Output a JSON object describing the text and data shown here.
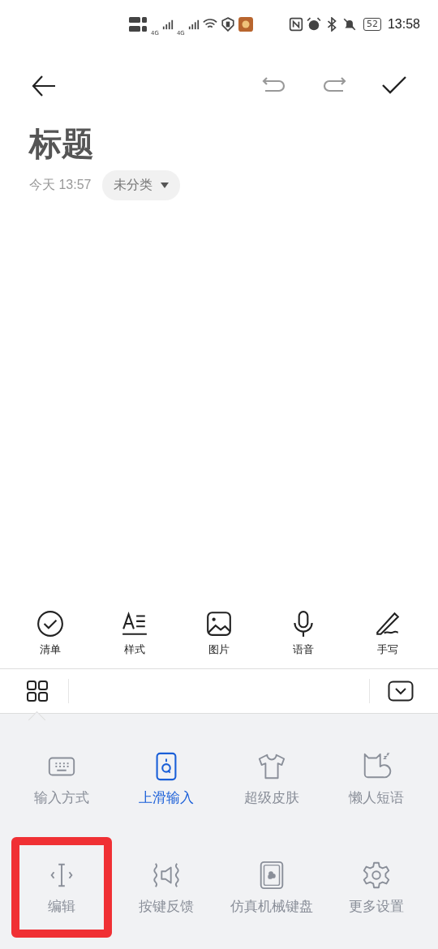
{
  "status_bar": {
    "networks": [
      "4G",
      "4G"
    ],
    "battery": "52",
    "time": "13:58"
  },
  "header": {
    "title": "标题",
    "date": "今天 13:57",
    "category": "未分类"
  },
  "toolbar": [
    {
      "kind": "checklist",
      "label": "清单"
    },
    {
      "kind": "style",
      "label": "样式"
    },
    {
      "kind": "image",
      "label": "图片"
    },
    {
      "kind": "voice",
      "label": "语音"
    },
    {
      "kind": "handwrite",
      "label": "手写"
    }
  ],
  "keyboard_menu": [
    {
      "kind": "keyboard",
      "label": "输入方式",
      "selected": false,
      "highlighted": false
    },
    {
      "kind": "swipe",
      "label": "上滑输入",
      "selected": true,
      "highlighted": false
    },
    {
      "kind": "skin",
      "label": "超级皮肤",
      "selected": false,
      "highlighted": false
    },
    {
      "kind": "phrases",
      "label": "懒人短语",
      "selected": false,
      "highlighted": false
    },
    {
      "kind": "edit",
      "label": "编辑",
      "selected": false,
      "highlighted": true
    },
    {
      "kind": "feedback",
      "label": "按键反馈",
      "selected": false,
      "highlighted": false
    },
    {
      "kind": "mechanical",
      "label": "仿真机械键盘",
      "selected": false,
      "highlighted": false
    },
    {
      "kind": "settings",
      "label": "更多设置",
      "selected": false,
      "highlighted": false
    }
  ]
}
